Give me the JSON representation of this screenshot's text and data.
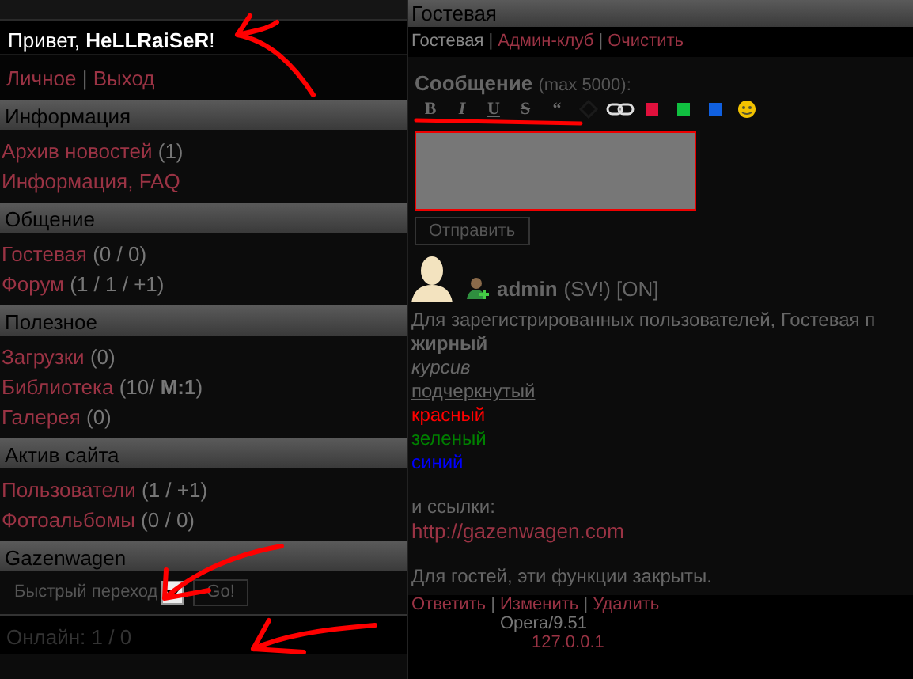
{
  "greeting": "Привет, **HeLLRaiSeR**!",
  "user_links": {
    "items": [
      "Личное",
      "Выход"
    ],
    "separator": "|"
  },
  "sections": [
    {
      "title": "Информация",
      "items": [
        {
          "label": "Архив новостей",
          "count": "(1)"
        },
        {
          "label": "Информация, FAQ"
        }
      ]
    },
    {
      "title": "Общение",
      "items": [
        {
          "label": "Гостевая",
          "count": "(0 / 0)"
        },
        {
          "label": "Форум",
          "count": "(1 / 1 / +1)"
        }
      ]
    },
    {
      "title": "Полезное",
      "items": [
        {
          "label": "Загрузки",
          "count": "(0)"
        },
        {
          "label": "Библиотека",
          "count": "(10/ **M:1**)"
        },
        {
          "label": "Галерея",
          "count": "(0)"
        }
      ]
    },
    {
      "title": "Актив сайта",
      "items": [
        {
          "label": "Пользователи",
          "count": "(1 / +1)"
        },
        {
          "label": "Фотоальбомы",
          "count": "(0 / 0)"
        }
      ]
    },
    {
      "title": "Gazenwagen"
    }
  ],
  "quick_jump": {
    "label": "Быстрый переход",
    "button": "Go!"
  },
  "online": "Онлайн: 1 / 0",
  "panel_title": "Гостевая",
  "nav": {
    "tabs": [
      {
        "label": "Гостевая",
        "selected": true
      },
      {
        "label": "Админ-клуб",
        "selected": false
      },
      {
        "label": "Очистить",
        "selected": false
      }
    ],
    "separator": "|"
  },
  "form": {
    "label": "Сообщение",
    "hint": "(max 5000):",
    "submit": "Отправить",
    "toolbar": [
      {
        "kind": "bold",
        "label": "B"
      },
      {
        "kind": "italic",
        "label": "I"
      },
      {
        "kind": "underline",
        "label": "U"
      },
      {
        "kind": "strike",
        "label": "S"
      },
      {
        "kind": "quote",
        "label": "“"
      },
      {
        "kind": "code"
      },
      {
        "kind": "link"
      },
      {
        "kind": "color",
        "color": "#e0103c"
      },
      {
        "kind": "color",
        "color": "#10c040"
      },
      {
        "kind": "color",
        "color": "#1060e0"
      },
      {
        "kind": "smiley"
      }
    ]
  },
  "post": {
    "author": "admin",
    "meta": "(SV!) [ON]",
    "paragraphs": [
      [
        {
          "kind": "text",
          "text": "Для зарегистрированных пользователей, Гостевая п"
        },
        {
          "kind": "bold",
          "text": "жирный"
        },
        {
          "kind": "italic",
          "text": "курсив"
        },
        {
          "kind": "underline",
          "text": "подчеркнутый"
        },
        {
          "kind": "color",
          "text": "красный",
          "color": "#ff0000"
        },
        {
          "kind": "color",
          "text": "зеленый",
          "color": "#008000"
        },
        {
          "kind": "color",
          "text": "синий",
          "color": "#0000ff"
        }
      ],
      [
        {
          "kind": "text",
          "text": "и ссылки:"
        },
        {
          "kind": "link",
          "text": "http://gazenwagen.com"
        }
      ],
      [
        {
          "kind": "text",
          "text": "Для гостей, эти функции закрыты."
        }
      ]
    ],
    "actions": {
      "items": [
        "Ответить",
        "Изменить",
        "Удалить"
      ],
      "separator": "|"
    },
    "browser": "Opera/9.51",
    "ip": "127.0.0.1"
  }
}
